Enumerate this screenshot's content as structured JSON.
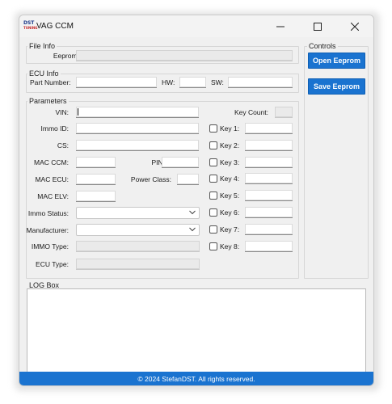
{
  "window": {
    "title": "VAG CCM",
    "logo_text": "DST",
    "logo_subtext": "TUNING"
  },
  "file_info": {
    "section": "File Info",
    "eeprom_file_label": "Eeprom File:",
    "eeprom_file_value": ""
  },
  "ecu_info": {
    "section": "ECU Info",
    "part_number_label": "Part Number:",
    "part_number_value": "",
    "hw_label": "HW:",
    "hw_value": "",
    "sw_label": "SW:",
    "sw_value": ""
  },
  "controls": {
    "section": "Controls",
    "open_eeprom": "Open Eeprom",
    "save_eeprom": "Save Eeprom"
  },
  "parameters": {
    "section": "Parameters",
    "vin_label": "VIN:",
    "vin_value": "",
    "immo_id_label": "Immo ID:",
    "immo_id_value": "",
    "cs_label": "CS:",
    "cs_value": "",
    "mac_ccm_label": "MAC CCM:",
    "mac_ccm_value": "",
    "pin_label": "PIN:",
    "pin_value": "",
    "mac_ecu_label": "MAC ECU:",
    "mac_ecu_value": "",
    "power_class_label": "Power Class:",
    "power_class_value": "",
    "mac_elv_label": "MAC ELV:",
    "mac_elv_value": "",
    "immo_status_label": "Immo Status:",
    "immo_status_value": "",
    "manufacturer_label": "Manufacturer:",
    "manufacturer_value": "",
    "immo_type_label": "IMMO Type:",
    "immo_type_value": "",
    "ecu_type_label": "ECU Type:",
    "ecu_type_value": "",
    "key_count_label": "Key Count:",
    "key_count_value": "",
    "keys": [
      {
        "label": "Key 1:",
        "value": ""
      },
      {
        "label": "Key 2:",
        "value": ""
      },
      {
        "label": "Key 3:",
        "value": ""
      },
      {
        "label": "Key 4:",
        "value": ""
      },
      {
        "label": "Key 5:",
        "value": ""
      },
      {
        "label": "Key 6:",
        "value": ""
      },
      {
        "label": "Key 7:",
        "value": ""
      },
      {
        "label": "Key 8:",
        "value": ""
      }
    ]
  },
  "log": {
    "section": "LOG Box",
    "content": ""
  },
  "footer": {
    "text": "© 2024 StefanDST. All rights reserved."
  },
  "colors": {
    "accent": "#1a73d0",
    "window_bg": "#f0f0f0"
  }
}
